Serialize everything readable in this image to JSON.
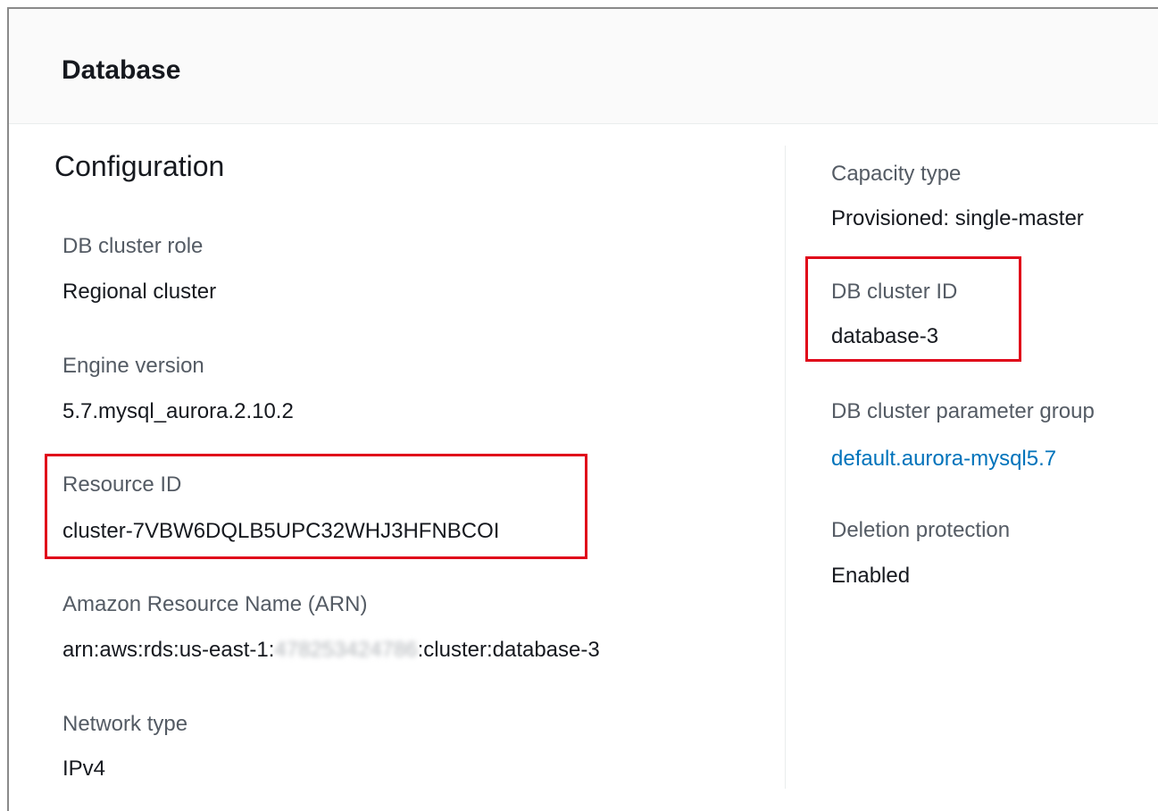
{
  "panel": {
    "title": "Database"
  },
  "section": {
    "title": "Configuration"
  },
  "left_fields": {
    "cluster_role": {
      "label": "DB cluster role",
      "value": "Regional cluster"
    },
    "engine_version": {
      "label": "Engine version",
      "value": "5.7.mysql_aurora.2.10.2"
    },
    "resource_id": {
      "label": "Resource ID",
      "value": "cluster-7VBW6DQLB5UPC32WHJ3HFNBCOI"
    },
    "arn": {
      "label": "Amazon Resource Name (ARN)",
      "value_prefix": "arn:aws:rds:us-east-1:",
      "value_redacted": "478253424786",
      "value_suffix": ":cluster:database-3"
    },
    "network_type": {
      "label": "Network type",
      "value": "IPv4"
    }
  },
  "right_fields": {
    "capacity_type": {
      "label": "Capacity type",
      "value": "Provisioned: single-master"
    },
    "cluster_id": {
      "label": "DB cluster ID",
      "value": "database-3"
    },
    "parameter_group": {
      "label": "DB cluster parameter group",
      "link": "default.aurora-mysql5.7"
    },
    "deletion_protection": {
      "label": "Deletion protection",
      "value": "Enabled"
    }
  },
  "colors": {
    "label": "#545b64",
    "value": "#16191f",
    "link": "#0073bb",
    "highlight": "#e0061a"
  }
}
